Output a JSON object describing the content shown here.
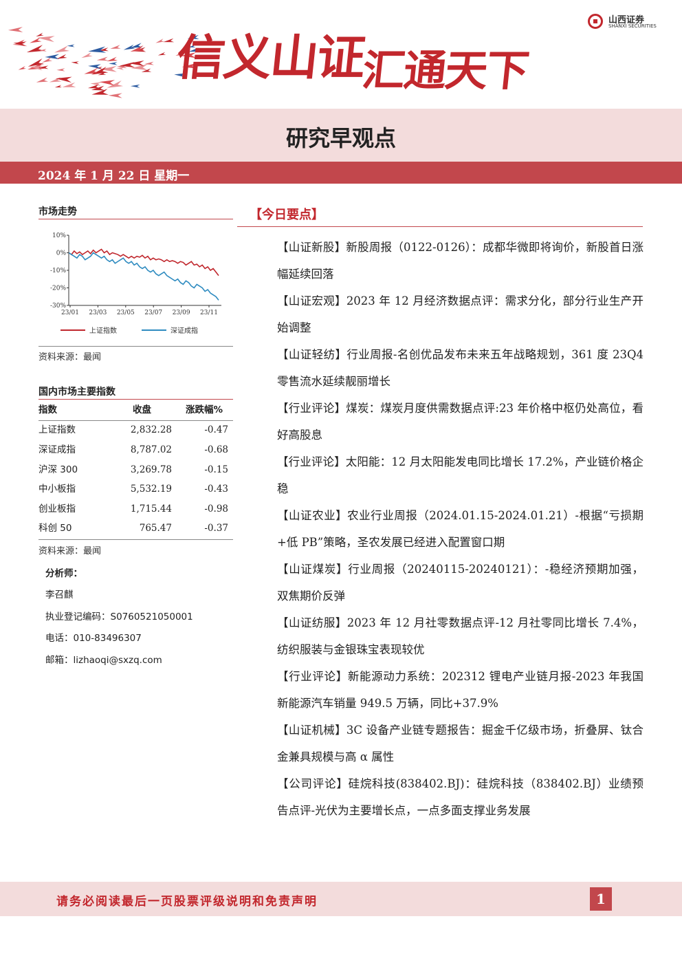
{
  "header": {
    "slogan_part1": "信义山证",
    "slogan_part2": "汇通天下",
    "logo_cn": "山西证券",
    "logo_en": "SHANXI SECURITIES"
  },
  "title": "研究早观点",
  "date": "2024 年 1 月 22 日   星期一",
  "market": {
    "title": "市场走势",
    "source": "资料来源：最闻"
  },
  "chart_data": {
    "type": "line",
    "x_tick_labels": [
      "23/01",
      "23/03",
      "23/05",
      "23/07",
      "23/09",
      "23/11"
    ],
    "y_tick_labels": [
      "10%",
      "0%",
      "-10%",
      "-20%",
      "-30%"
    ],
    "ylim": [
      -30,
      10
    ],
    "grid": false,
    "legend_position": "bottom",
    "series": [
      {
        "name": "上证指数",
        "color": "#c0272d",
        "values": [
          0,
          -1,
          1,
          -0.5,
          0.5,
          -1,
          0,
          1,
          -0.5,
          1.5,
          0,
          1,
          2,
          0,
          1,
          -1,
          0,
          -0.5,
          -1,
          -2,
          -1,
          -2,
          -3,
          -2,
          -3,
          -2,
          -2.5,
          -1.5,
          -3,
          -2,
          -4,
          -3,
          -4,
          -3.5,
          -4,
          -5,
          -4,
          -5,
          -4.5,
          -5,
          -6,
          -5,
          -5.5,
          -7,
          -6,
          -5,
          -7,
          -6.5,
          -8,
          -7,
          -9,
          -8,
          -10,
          -9,
          -11,
          -13
        ]
      },
      {
        "name": "深证成指",
        "color": "#2e8bc0",
        "values": [
          0,
          -1,
          -2,
          -3,
          -1,
          -2,
          -4,
          -3,
          -2,
          0,
          -1,
          -2,
          -3,
          -2,
          -4,
          -5,
          -4,
          -6,
          -5,
          -4,
          -3,
          -5,
          -6,
          -5,
          -7,
          -6,
          -8,
          -9,
          -8,
          -10,
          -11,
          -10,
          -12,
          -13,
          -12,
          -11,
          -13,
          -14,
          -15,
          -16,
          -15,
          -17,
          -18,
          -16,
          -17,
          -19,
          -20,
          -18,
          -19,
          -20,
          -22,
          -21,
          -23,
          -24,
          -25,
          -27
        ]
      }
    ]
  },
  "indices": {
    "title": "国内市场主要指数",
    "headers": [
      "指数",
      "收盘",
      "涨跌幅%"
    ],
    "rows": [
      {
        "name": "上证指数",
        "close": "2,832.28",
        "change": "-0.47"
      },
      {
        "name": "深证成指",
        "close": "8,787.02",
        "change": "-0.68"
      },
      {
        "name": "沪深 300",
        "close": "3,269.78",
        "change": "-0.15"
      },
      {
        "name": "中小板指",
        "close": "5,532.19",
        "change": "-0.43"
      },
      {
        "name": "创业板指",
        "close": "1,715.44",
        "change": "-0.98"
      },
      {
        "name": "科创 50",
        "close": "765.47",
        "change": "-0.37"
      }
    ],
    "source": "资料来源：最闻"
  },
  "analyst": {
    "label": "分析师：",
    "name": "李召麒",
    "license": "执业登记编码：S0760521050001",
    "phone": "电话：010-83496307",
    "email": "邮箱：lizhaoqi@sxzq.com"
  },
  "today": {
    "title": "【今日要点】",
    "items": [
      "【山证新股】新股周报（0122-0126）：成都华微即将询价，新股首日涨幅延续回落",
      "【山证宏观】2023 年 12 月经济数据点评：需求分化，部分行业生产开始调整",
      "【山证轻纺】行业周报-名创优品发布未来五年战略规划，361 度 23Q4 零售流水延续靓丽增长",
      "【行业评论】煤炭：煤炭月度供需数据点评:23 年价格中枢仍处高位，看好高股息",
      "【行业评论】太阳能：12 月太阳能发电同比增长 17.2%，产业链价格企稳",
      "【山证农业】农业行业周报（2024.01.15-2024.01.21）-根据“亏损期+低 PB”策略，圣农发展已经进入配置窗口期",
      "【山证煤炭】行业周报（20240115-20240121）：-稳经济预期加强，双焦期价反弹",
      "【山证纺服】2023 年 12 月社零数据点评-12 月社零同比增长 7.4%，纺织服装与金银珠宝表现较优",
      "【行业评论】新能源动力系统：202312 锂电产业链月报-2023 年我国新能源汽车销量 949.5 万辆，同比+37.9%",
      "【山证机械】3C 设备产业链专题报告：掘金千亿级市场，折叠屏、钛合金兼具规模与高 α 属性",
      "【公司评论】硅烷科技(838402.BJ)：硅烷科技（838402.BJ）业绩预告点评-光伏为主要增长点，一点多面支撑业务发展"
    ]
  },
  "footer": {
    "disclaimer": "请务必阅读最后一页股票评级说明和免责声明",
    "page": "1"
  }
}
